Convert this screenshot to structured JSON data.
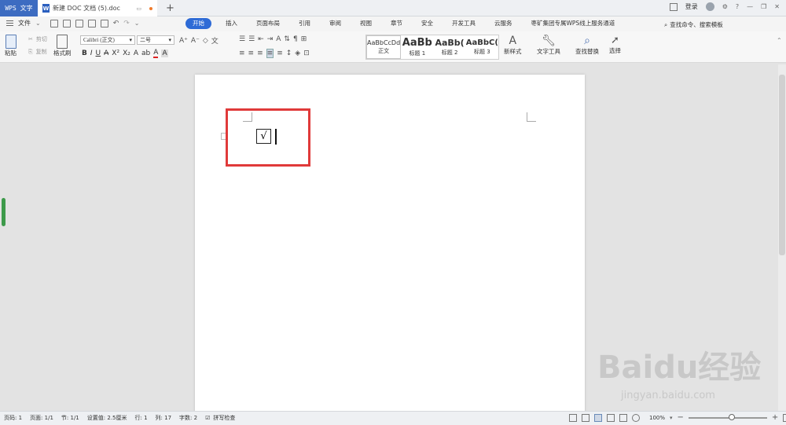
{
  "titlebar": {
    "app_name": "WPS 文字",
    "doc_tab": "新建 DOC 文档 (5).doc",
    "new_tab": "+",
    "login": "登录"
  },
  "menubar": {
    "file": "文件",
    "tabs": [
      "开始",
      "插入",
      "页面布局",
      "引用",
      "审阅",
      "视图",
      "章节",
      "安全",
      "开发工具",
      "云服务",
      "枣矿集团专属WPS线上服务通道"
    ],
    "search": "查找命令、搜索模板"
  },
  "ribbon": {
    "paste": "粘贴",
    "cut": "剪切",
    "copy": "复制",
    "format_painter": "格式刷",
    "font_name": "Calibri (正文)",
    "font_size": "二号",
    "styles": [
      {
        "preview": "AaBbCcDd",
        "name": "正文"
      },
      {
        "preview": "AaBb",
        "name": "标题 1"
      },
      {
        "preview": "AaBb(",
        "name": "标题 2"
      },
      {
        "preview": "AaBbC(",
        "name": "标题 3"
      }
    ],
    "new_style": "新样式",
    "text_tools": "文字工具",
    "find_replace": "查找替换",
    "select": "选择"
  },
  "document": {
    "checkbox_glyph": "√"
  },
  "statusbar": {
    "page_code": "页码: 1",
    "pages": "页面: 1/1",
    "section": "节: 1/1",
    "setting": "设置值: 2.5厘米",
    "row": "行: 1",
    "col": "列: 17",
    "word_count": "字数: 2",
    "spell_check": "拼写检查",
    "zoom": "100%"
  },
  "watermark": {
    "brand": "Baidu经验",
    "url": "jingyan.baidu.com"
  },
  "colors": {
    "accent": "#2e6bd6",
    "highlight_box": "#e03a3a",
    "app_tab": "#3d6cc1"
  },
  "zoom_level": 0.55
}
